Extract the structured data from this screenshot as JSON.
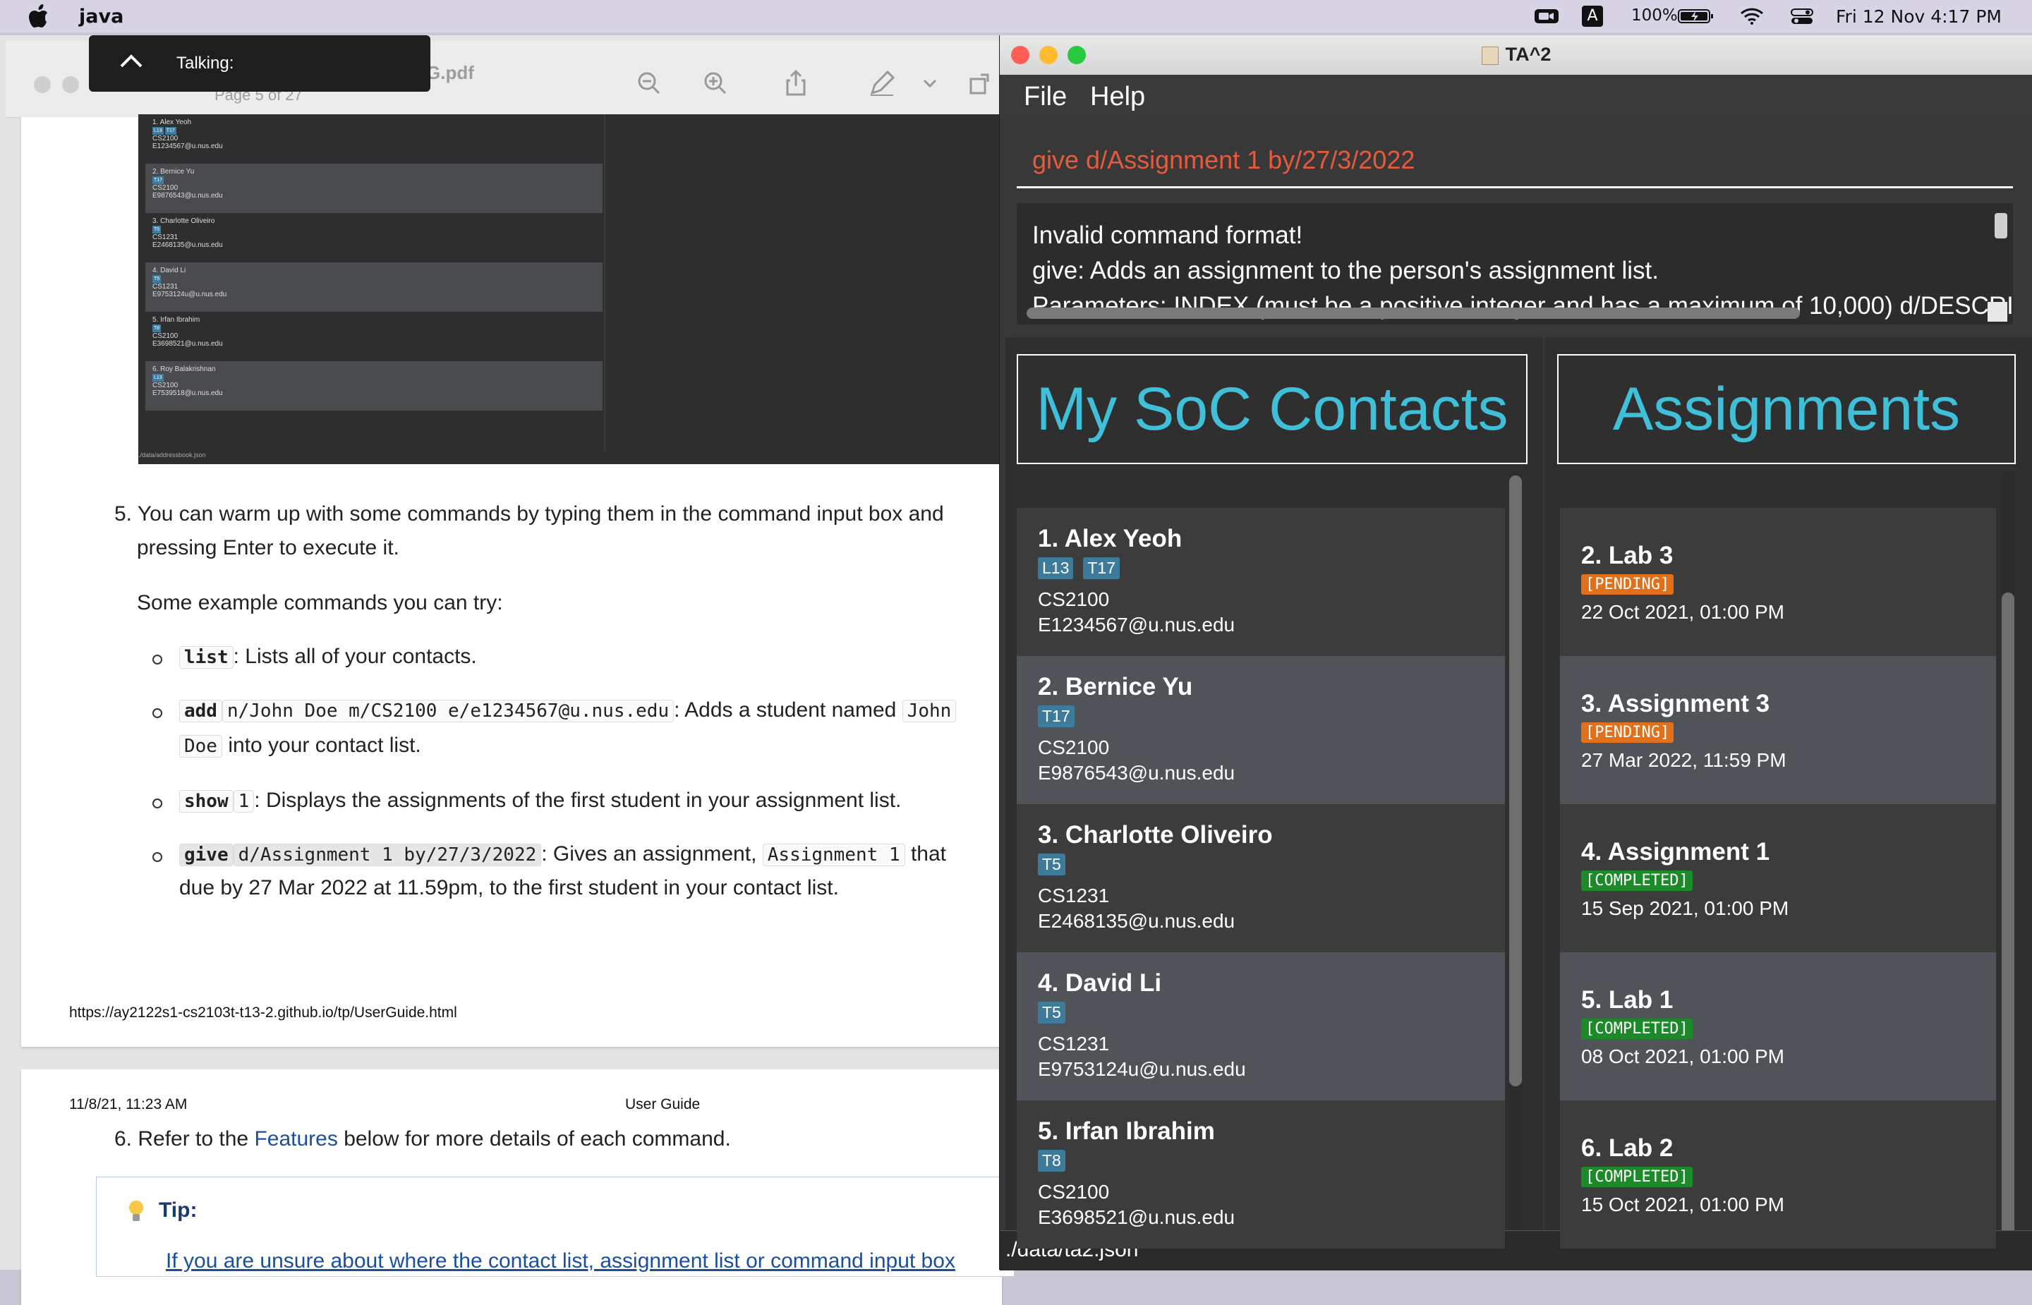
{
  "menubar": {
    "app_name": "java",
    "battery": "100%",
    "datetime": "Fri 12 Nov  4:17 PM",
    "input_source": "A"
  },
  "talking": {
    "label": "Talking:"
  },
  "pdf": {
    "title": "G.pdf",
    "page_indicator": "Page 5 of 27",
    "thumbnail": {
      "contacts": [
        {
          "name": "1.  Alex Yeoh",
          "tags": [
            "L13",
            "T17"
          ],
          "module": "CS2100",
          "email": "E1234567@u.nus.edu"
        },
        {
          "name": "2.  Bernice Yu",
          "tags": [
            "T17"
          ],
          "module": "CS2100",
          "email": "E9876543@u.nus.edu"
        },
        {
          "name": "3.  Charlotte Oliveiro",
          "tags": [
            "T5"
          ],
          "module": "CS1231",
          "email": "E2468135@u.nus.edu"
        },
        {
          "name": "4.  David Li",
          "tags": [
            "T5"
          ],
          "module": "CS1231",
          "email": "E9753124u@u.nus.edu"
        },
        {
          "name": "5.  Irfan Ibrahim",
          "tags": [
            "T8"
          ],
          "module": "CS2100",
          "email": "E3698521@u.nus.edu"
        },
        {
          "name": "6.  Roy Balakrishnan",
          "tags": [
            "L13"
          ],
          "module": "CS2100",
          "email": "E7539518@u.nus.edu"
        }
      ],
      "status": "./data/addressbook.json"
    },
    "step5_line1": "5. You can warm up with some commands by typing them in the command input box and",
    "step5_line2": "pressing Enter to execute it.",
    "examples_intro": "Some example commands you can try:",
    "ex1_code": "list",
    "ex1_text": ": Lists all of your contacts.",
    "ex2_code": "add",
    "ex2_args": "n/John Doe m/CS2100 e/e1234567@u.nus.edu",
    "ex2_text": ": Adds a student named",
    "ex2_code2": "John",
    "ex2_code3": "Doe",
    "ex2_text2": "into your contact list.",
    "ex3_code": "show",
    "ex3_args": "1",
    "ex3_text": ": Displays the assignments of the first student in your assignment list.",
    "ex4_code": "give",
    "ex4_args": "d/Assignment 1 by/27/3/2022",
    "ex4_text": ": Gives an assignment,",
    "ex4_code2": "Assignment 1",
    "ex4_text2": "that",
    "ex4_line2": "due by 27 Mar 2022 at 11.59pm, to the first student in your contact list.",
    "footer_url": "https://ay2122s1-cs2103t-t13-2.github.io/tp/UserGuide.html",
    "page2_date": "11/8/21, 11:23 AM",
    "page2_header": "User Guide",
    "step6_prefix": "6. Refer to the",
    "step6_link": "Features",
    "step6_suffix": "below for more details of each command.",
    "tip_title": "Tip:",
    "tip_line": "If you are unsure about where the contact list, assignment list or command input box"
  },
  "app": {
    "title": "TA^2",
    "menu": [
      "File",
      "Help"
    ],
    "command_input": "give d/Assignment 1 by/27/3/2022",
    "result_lines": [
      "Invalid command format!",
      "give: Adds an assignment to the person's assignment list.",
      "Parameters: INDEX (must be a positive integer and has a maximum of 10,000) d/DESCRI"
    ],
    "contacts_header": "My SoC Contacts",
    "assignments_header": "Assignments",
    "contacts": [
      {
        "index": "1.",
        "name": "Alex Yeoh",
        "tags": [
          "L13",
          "T17"
        ],
        "module": "CS2100",
        "email": "E1234567@u.nus.edu"
      },
      {
        "index": "2.",
        "name": "Bernice Yu",
        "tags": [
          "T17"
        ],
        "module": "CS2100",
        "email": "E9876543@u.nus.edu"
      },
      {
        "index": "3.",
        "name": "Charlotte Oliveiro",
        "tags": [
          "T5"
        ],
        "module": "CS1231",
        "email": "E2468135@u.nus.edu"
      },
      {
        "index": "4.",
        "name": "David Li",
        "tags": [
          "T5"
        ],
        "module": "CS1231",
        "email": "E9753124u@u.nus.edu"
      },
      {
        "index": "5.",
        "name": "Irfan Ibrahim",
        "tags": [
          "T8"
        ],
        "module": "CS2100",
        "email": "E3698521@u.nus.edu"
      }
    ],
    "assignments": [
      {
        "index": "2.",
        "name": "Lab 3",
        "status": "[PENDING]",
        "status_kind": "pending",
        "due": "22 Oct 2021, 01:00 PM"
      },
      {
        "index": "3.",
        "name": "Assignment 3",
        "status": "[PENDING]",
        "status_kind": "pending",
        "due": "27 Mar 2022, 11:59 PM"
      },
      {
        "index": "4.",
        "name": "Assignment 1",
        "status": "[COMPLETED]",
        "status_kind": "completed",
        "due": "15 Sep 2021, 01:00 PM"
      },
      {
        "index": "5.",
        "name": "Lab 1",
        "status": "[COMPLETED]",
        "status_kind": "completed",
        "due": "08 Oct 2021, 01:00 PM"
      },
      {
        "index": "6.",
        "name": "Lab 2",
        "status": "[COMPLETED]",
        "status_kind": "completed",
        "due": "15 Oct 2021, 01:00 PM"
      }
    ],
    "status_path": "./data/ta2.json",
    "colors": {
      "header_text": "#3fc0d8",
      "tag": "#3e7b9a",
      "pending": "#e0701a",
      "completed": "#1d8a2a",
      "command_error": "#e55b3c"
    }
  }
}
